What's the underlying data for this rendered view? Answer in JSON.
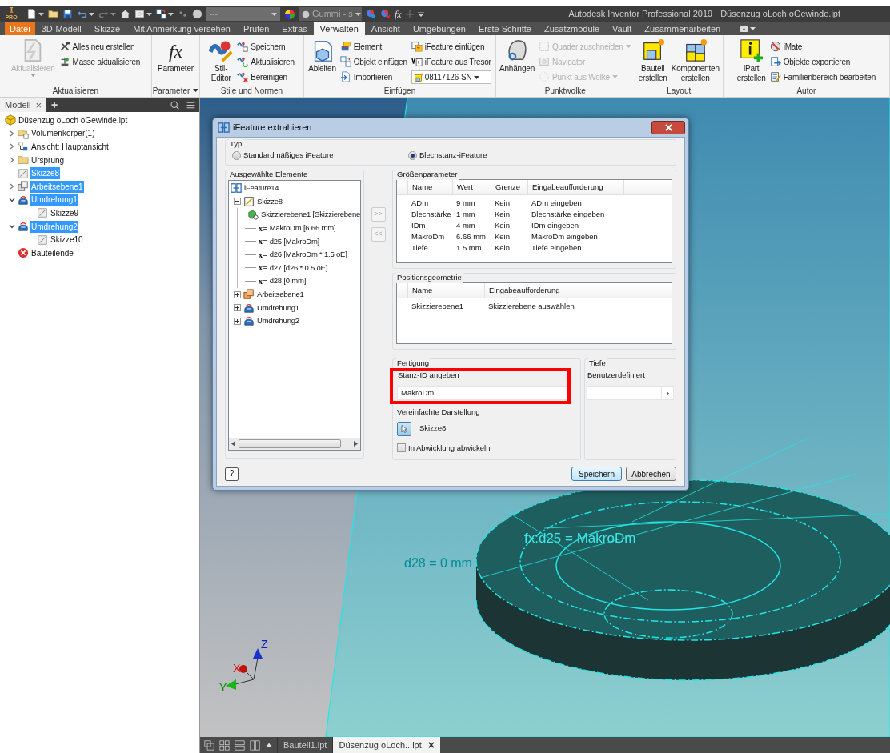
{
  "title_bar": {
    "logo_badge": "PRO",
    "style_box": "---",
    "material_box": "Gummi - s",
    "formula_glyph": "fx",
    "app_title": "Autodesk Inventor Professional 2019",
    "document_title": "Düsenzug oLoch oGewinde.ipt"
  },
  "ribbon_tabs": [
    {
      "label": "Datei",
      "kind": "file",
      "selected": false
    },
    {
      "label": "3D-Modell",
      "kind": "tab",
      "selected": false
    },
    {
      "label": "Skizze",
      "kind": "tab",
      "selected": false
    },
    {
      "label": "Mit Anmerkung versehen",
      "kind": "tab",
      "selected": false
    },
    {
      "label": "Prüfen",
      "kind": "tab",
      "selected": false
    },
    {
      "label": "Extras",
      "kind": "tab",
      "selected": false
    },
    {
      "label": "Verwalten",
      "kind": "tab",
      "selected": true
    },
    {
      "label": "Ansicht",
      "kind": "tab",
      "selected": false
    },
    {
      "label": "Umgebungen",
      "kind": "tab",
      "selected": false
    },
    {
      "label": "Erste Schritte",
      "kind": "tab",
      "selected": false
    },
    {
      "label": "Zusatzmodule",
      "kind": "tab",
      "selected": false
    },
    {
      "label": "Vault",
      "kind": "tab",
      "selected": false
    },
    {
      "label": "Zusammenarbeiten",
      "kind": "tab",
      "selected": false
    }
  ],
  "ribbon_panels": [
    {
      "label": "Aktualisieren",
      "large_buttons": [
        {
          "label": "Aktualisieren",
          "disabled": true,
          "menu": true
        }
      ],
      "small_columns": [
        [
          {
            "label": "Alles neu erstellen",
            "disabled": false
          },
          {
            "label": "Masse aktualisieren",
            "disabled": false
          }
        ]
      ]
    },
    {
      "label": "Parameter",
      "menu": true,
      "large_buttons": [
        {
          "label": "Parameter",
          "disabled": false,
          "glyph": "fx"
        }
      ]
    },
    {
      "label": "Stile und Normen",
      "large_buttons": [
        {
          "label": "Stil-Editor",
          "disabled": false
        }
      ],
      "small_columns": [
        [
          {
            "label": "Speichern",
            "disabled": false
          },
          {
            "label": "Aktualisieren",
            "disabled": false
          },
          {
            "label": "Bereinigen",
            "disabled": false
          }
        ]
      ]
    },
    {
      "label": "Einfügen",
      "large_buttons": [
        {
          "label": "Ableiten",
          "disabled": false
        }
      ],
      "small_columns": [
        [
          {
            "label": "Element",
            "disabled": false
          },
          {
            "label": "Objekt einfügen",
            "disabled": false
          },
          {
            "label": "Importieren",
            "disabled": false
          }
        ],
        [
          {
            "label": "iFeature einfügen",
            "disabled": false
          },
          {
            "label": "iFeature aus Tresor",
            "disabled": false
          }
        ]
      ],
      "dropdown": {
        "label": "08117126-SN"
      }
    },
    {
      "label": "Punktwolke",
      "large_buttons": [
        {
          "label": "Anhängen",
          "disabled": false
        }
      ],
      "small_columns": [
        [
          {
            "label": "Quader zuschneiden",
            "disabled": true,
            "menu": true
          },
          {
            "label": "Navigator",
            "disabled": true
          },
          {
            "label": "Punkt aus Wolke",
            "disabled": true,
            "menu": true
          }
        ]
      ]
    },
    {
      "label": "Layout",
      "large_buttons": [
        {
          "label": "Bauteil erstellen",
          "disabled": false
        },
        {
          "label": "Komponenten erstellen",
          "disabled": false
        }
      ]
    },
    {
      "label": "Autor",
      "large_buttons": [
        {
          "label": "iPart erstellen",
          "disabled": false
        }
      ],
      "small_columns": [
        [
          {
            "label": "iMate",
            "disabled": false
          },
          {
            "label": "Objekte exportieren",
            "disabled": false
          },
          {
            "label": "Familienbereich bearbeiten",
            "disabled": false
          }
        ]
      ]
    }
  ],
  "browser": {
    "tab": "Modell",
    "close_glyph": "×",
    "add_glyph": "+",
    "tree": [
      {
        "label": "Düsenzug oLoch oGewinde.ipt",
        "kind": "part",
        "selected": false,
        "children": [
          {
            "label": "Volumenkörper(1)",
            "kind": "body",
            "selected": false,
            "expanded": false
          },
          {
            "label": "Ansicht: Hauptansicht",
            "kind": "view",
            "selected": false,
            "expanded": false
          },
          {
            "label": "Ursprung",
            "kind": "folder",
            "selected": false,
            "expanded": false
          },
          {
            "label": "Skizze8",
            "kind": "sketch",
            "selected": true
          },
          {
            "label": "Arbeitsebene1",
            "kind": "plane",
            "selected": true,
            "expanded": false
          },
          {
            "label": "Umdrehung1",
            "kind": "revolve",
            "selected": true,
            "expanded": true,
            "children": [
              {
                "label": "Skizze9",
                "kind": "sketch",
                "selected": false
              }
            ]
          },
          {
            "label": "Umdrehung2",
            "kind": "revolve",
            "selected": true,
            "expanded": true,
            "children": [
              {
                "label": "Skizze10",
                "kind": "sketch",
                "selected": false
              }
            ]
          },
          {
            "label": "Bauteilende",
            "kind": "end",
            "selected": false
          }
        ]
      }
    ]
  },
  "dialog": {
    "title": "iFeature extrahieren",
    "type_group": {
      "label": "Typ",
      "options": [
        {
          "label": "Standardmäßiges iFeature",
          "selected": false
        },
        {
          "label": "Blechstanz-iFeature",
          "selected": true
        }
      ]
    },
    "selected_elements": {
      "label": "Ausgewählte Elemente",
      "tree": [
        {
          "label": "iFeature14",
          "kind": "feature",
          "children": [
            {
              "label": "Skizze8",
              "kind": "sketch",
              "expanded": true,
              "children": [
                {
                  "label": "Skizzierebene1 [Skizzierebene",
                  "kind": "sketchplane"
                },
                {
                  "label": "MakroDm [6.66 mm]",
                  "kind": "parameter",
                  "marker": "x="
                },
                {
                  "label": "d25 [MakroDm]",
                  "kind": "parameter",
                  "marker": "x="
                },
                {
                  "label": "d26 [MakroDm * 1.5 oE]",
                  "kind": "parameter",
                  "marker": "x="
                },
                {
                  "label": "d27 [d26 * 0.5 oE]",
                  "kind": "parameter",
                  "marker": "x="
                },
                {
                  "label": "d28 [0 mm]",
                  "kind": "parameter",
                  "marker": "x="
                }
              ]
            },
            {
              "label": "Arbeitsebene1",
              "kind": "plane",
              "expanded": false
            },
            {
              "label": "Umdrehung1",
              "kind": "revolve",
              "expanded": false
            },
            {
              "label": "Umdrehung2",
              "kind": "revolve",
              "expanded": false
            }
          ]
        }
      ]
    },
    "move_buttons": [
      {
        "label": ">>",
        "disabled": true
      },
      {
        "label": "<<",
        "disabled": true
      }
    ],
    "size_parameters": {
      "label": "Größenparameter",
      "columns": [
        "Name",
        "Wert",
        "Grenze",
        "Eingabeaufforderung"
      ],
      "rows": [
        [
          "ADm",
          "9 mm",
          "Kein",
          "ADm eingeben"
        ],
        [
          "Blechstärke",
          "1 mm",
          "Kein",
          "Blechstärke eingeben"
        ],
        [
          "IDm",
          "4 mm",
          "Kein",
          "IDm eingeben"
        ],
        [
          "MakroDm",
          "6.66 mm",
          "Kein",
          "MakroDm eingeben"
        ],
        [
          "Tiefe",
          "1.5 mm",
          "Kein",
          "Tiefe eingeben"
        ]
      ]
    },
    "position_geometry": {
      "label": "Positionsgeometrie",
      "columns": [
        "Name",
        "Eingabeaufforderung"
      ],
      "rows": [
        [
          "Skizzierebene1",
          "Skizzierebene auswählen"
        ]
      ]
    },
    "manufacturing": {
      "label": "Fertigung",
      "punch_id_label": "Stanz-ID angeben",
      "punch_id_value": "MakroDm",
      "highlighted": true,
      "simplified_label": "Vereinfachte Darstellung",
      "simplified_value": "Skizze8",
      "unfold": {
        "label": "In Abwicklung abwickeln",
        "checked": false
      }
    },
    "depth": {
      "label": "Tiefe",
      "option_label": "Benutzerdefiniert"
    },
    "help_glyph": "?",
    "buttons": [
      {
        "label": "Speichern",
        "default": true
      },
      {
        "label": "Abbrechen",
        "default": false
      }
    ]
  },
  "viewport": {
    "annotations": [
      {
        "text": "fx:d25 = MakroDm",
        "kind": "formula"
      },
      {
        "text": "d28 = 0 mm",
        "kind": "dimension"
      }
    ],
    "axes": [
      "X",
      "Y",
      "Z"
    ]
  },
  "document_tabs": [
    {
      "label": "Bauteil1.ipt",
      "selected": false
    },
    {
      "label": "Düsenzug oLoch...ipt",
      "selected": true,
      "close_glyph": "×"
    }
  ]
}
